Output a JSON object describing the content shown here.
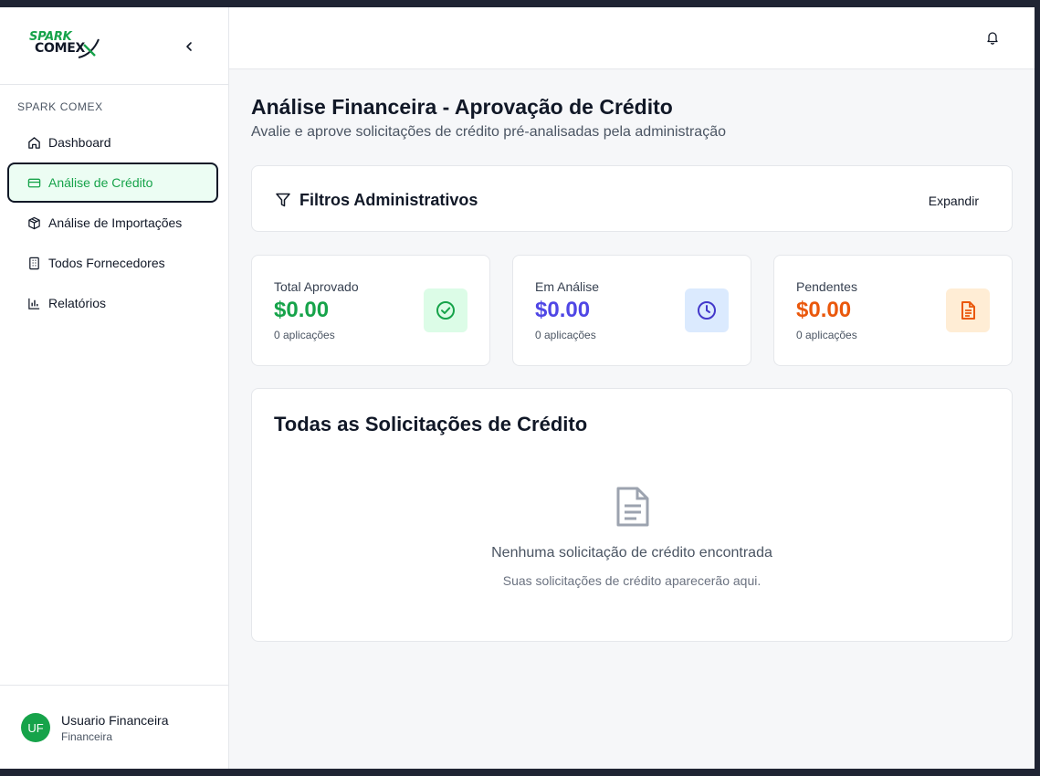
{
  "brand": {
    "logo_line1": "SPARK",
    "logo_line2": "COMEX"
  },
  "sidebar": {
    "section_label": "SPARK COMEX",
    "items": [
      {
        "label": "Dashboard",
        "icon": "home-icon",
        "active": false
      },
      {
        "label": "Análise de Crédito",
        "icon": "credit-card-icon",
        "active": true
      },
      {
        "label": "Análise de Importações",
        "icon": "package-icon",
        "active": false
      },
      {
        "label": "Todos Fornecedores",
        "icon": "building-icon",
        "active": false
      },
      {
        "label": "Relatórios",
        "icon": "bar-chart-icon",
        "active": false
      }
    ],
    "user": {
      "initials": "UF",
      "name": "Usuario Financeira",
      "role": "Financeira"
    }
  },
  "page": {
    "title": "Análise Financeira - Aprovação de Crédito",
    "subtitle": "Avalie e aprove solicitações de crédito pré-analisadas pela administração"
  },
  "filters": {
    "title": "Filtros Administrativos",
    "expand_label": "Expandir"
  },
  "stats": [
    {
      "label": "Total Aprovado",
      "value": "$0.00",
      "count": "0 aplicações",
      "icon": "check-circle-icon",
      "color": "#16a34a",
      "bg": "#dcfce7"
    },
    {
      "label": "Em Análise",
      "value": "$0.00",
      "count": "0 aplicações",
      "icon": "clock-icon",
      "color": "#4f46e5",
      "bg": "#dbeafe"
    },
    {
      "label": "Pendentes",
      "value": "$0.00",
      "count": "0 aplicações",
      "icon": "document-icon",
      "color": "#ea580c",
      "bg": "#ffedd5"
    }
  ],
  "requests": {
    "title": "Todas as Solicitações de Crédito",
    "empty_title": "Nenhuma solicitação de crédito encontrada",
    "empty_subtitle": "Suas solicitações de crédito aparecerão aqui."
  }
}
